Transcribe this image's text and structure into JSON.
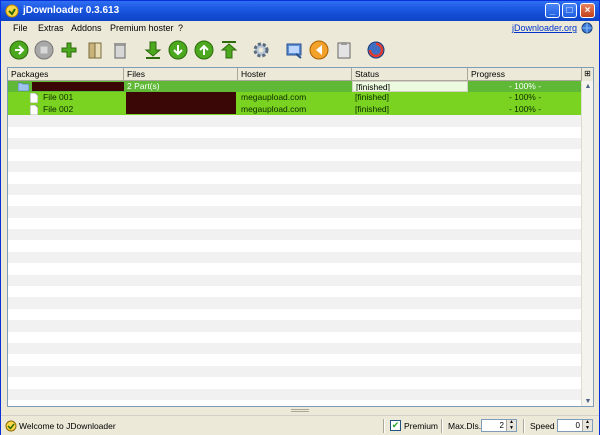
{
  "window": {
    "title": "jDownloader 0.3.613"
  },
  "menu": {
    "items": [
      "File",
      "Extras",
      "Addons",
      "Premium hoster",
      "?"
    ],
    "site_link": "jDownloader.org"
  },
  "table": {
    "columns": [
      "Packages",
      "Files",
      "Hoster",
      "Status",
      "Progress"
    ],
    "package_row": {
      "files": "2 Part(s)",
      "status": "[finished]",
      "progress": "- 100% -"
    },
    "file_rows": [
      {
        "name": "File 001",
        "hoster": "megaupload.com",
        "status": "[finished]",
        "progress": "- 100% -"
      },
      {
        "name": "File 002",
        "hoster": "megaupload.com",
        "status": "[finished]",
        "progress": "- 100% -"
      }
    ]
  },
  "status": {
    "message": "Welcome to JDownloader",
    "premium_label": "Premium",
    "premium_checked": true,
    "maxdls_label": "Max.Dls.",
    "maxdls_value": "2",
    "speed_label": "Speed",
    "speed_value": "0"
  },
  "colors": {
    "package_row": "#5fb936",
    "file_row": "#7bd321",
    "title_bar": "#1650d8"
  }
}
